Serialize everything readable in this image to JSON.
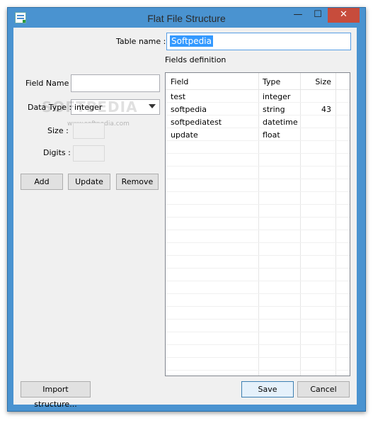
{
  "window": {
    "title": "Flat File Structure",
    "controls": {
      "minimize": "—",
      "maximize": "☐",
      "close": "✕"
    }
  },
  "table_name": {
    "label": "Table name :",
    "value": "Softpedia"
  },
  "fields_definition_label": "Fields definition",
  "field_name": {
    "label": "Field Name :",
    "value": ""
  },
  "data_type": {
    "label": "Data Type :",
    "selected": "integer"
  },
  "size": {
    "label": "Size :",
    "value": ""
  },
  "digits": {
    "label": "Digits :",
    "value": ""
  },
  "buttons": {
    "add": "Add",
    "update": "Update",
    "remove": "Remove",
    "import": "Import structure...",
    "save": "Save",
    "cancel": "Cancel"
  },
  "grid": {
    "columns": [
      "Field",
      "Type",
      "Size"
    ],
    "rows": [
      [
        "test",
        "integer",
        ""
      ],
      [
        "softpedia",
        "string",
        "43"
      ],
      [
        "softpediatest",
        "datetime",
        ""
      ],
      [
        "update",
        "float",
        ""
      ]
    ]
  },
  "watermark": {
    "main": "SOFTPEDIA",
    "sub": "www.softpedia.com"
  }
}
